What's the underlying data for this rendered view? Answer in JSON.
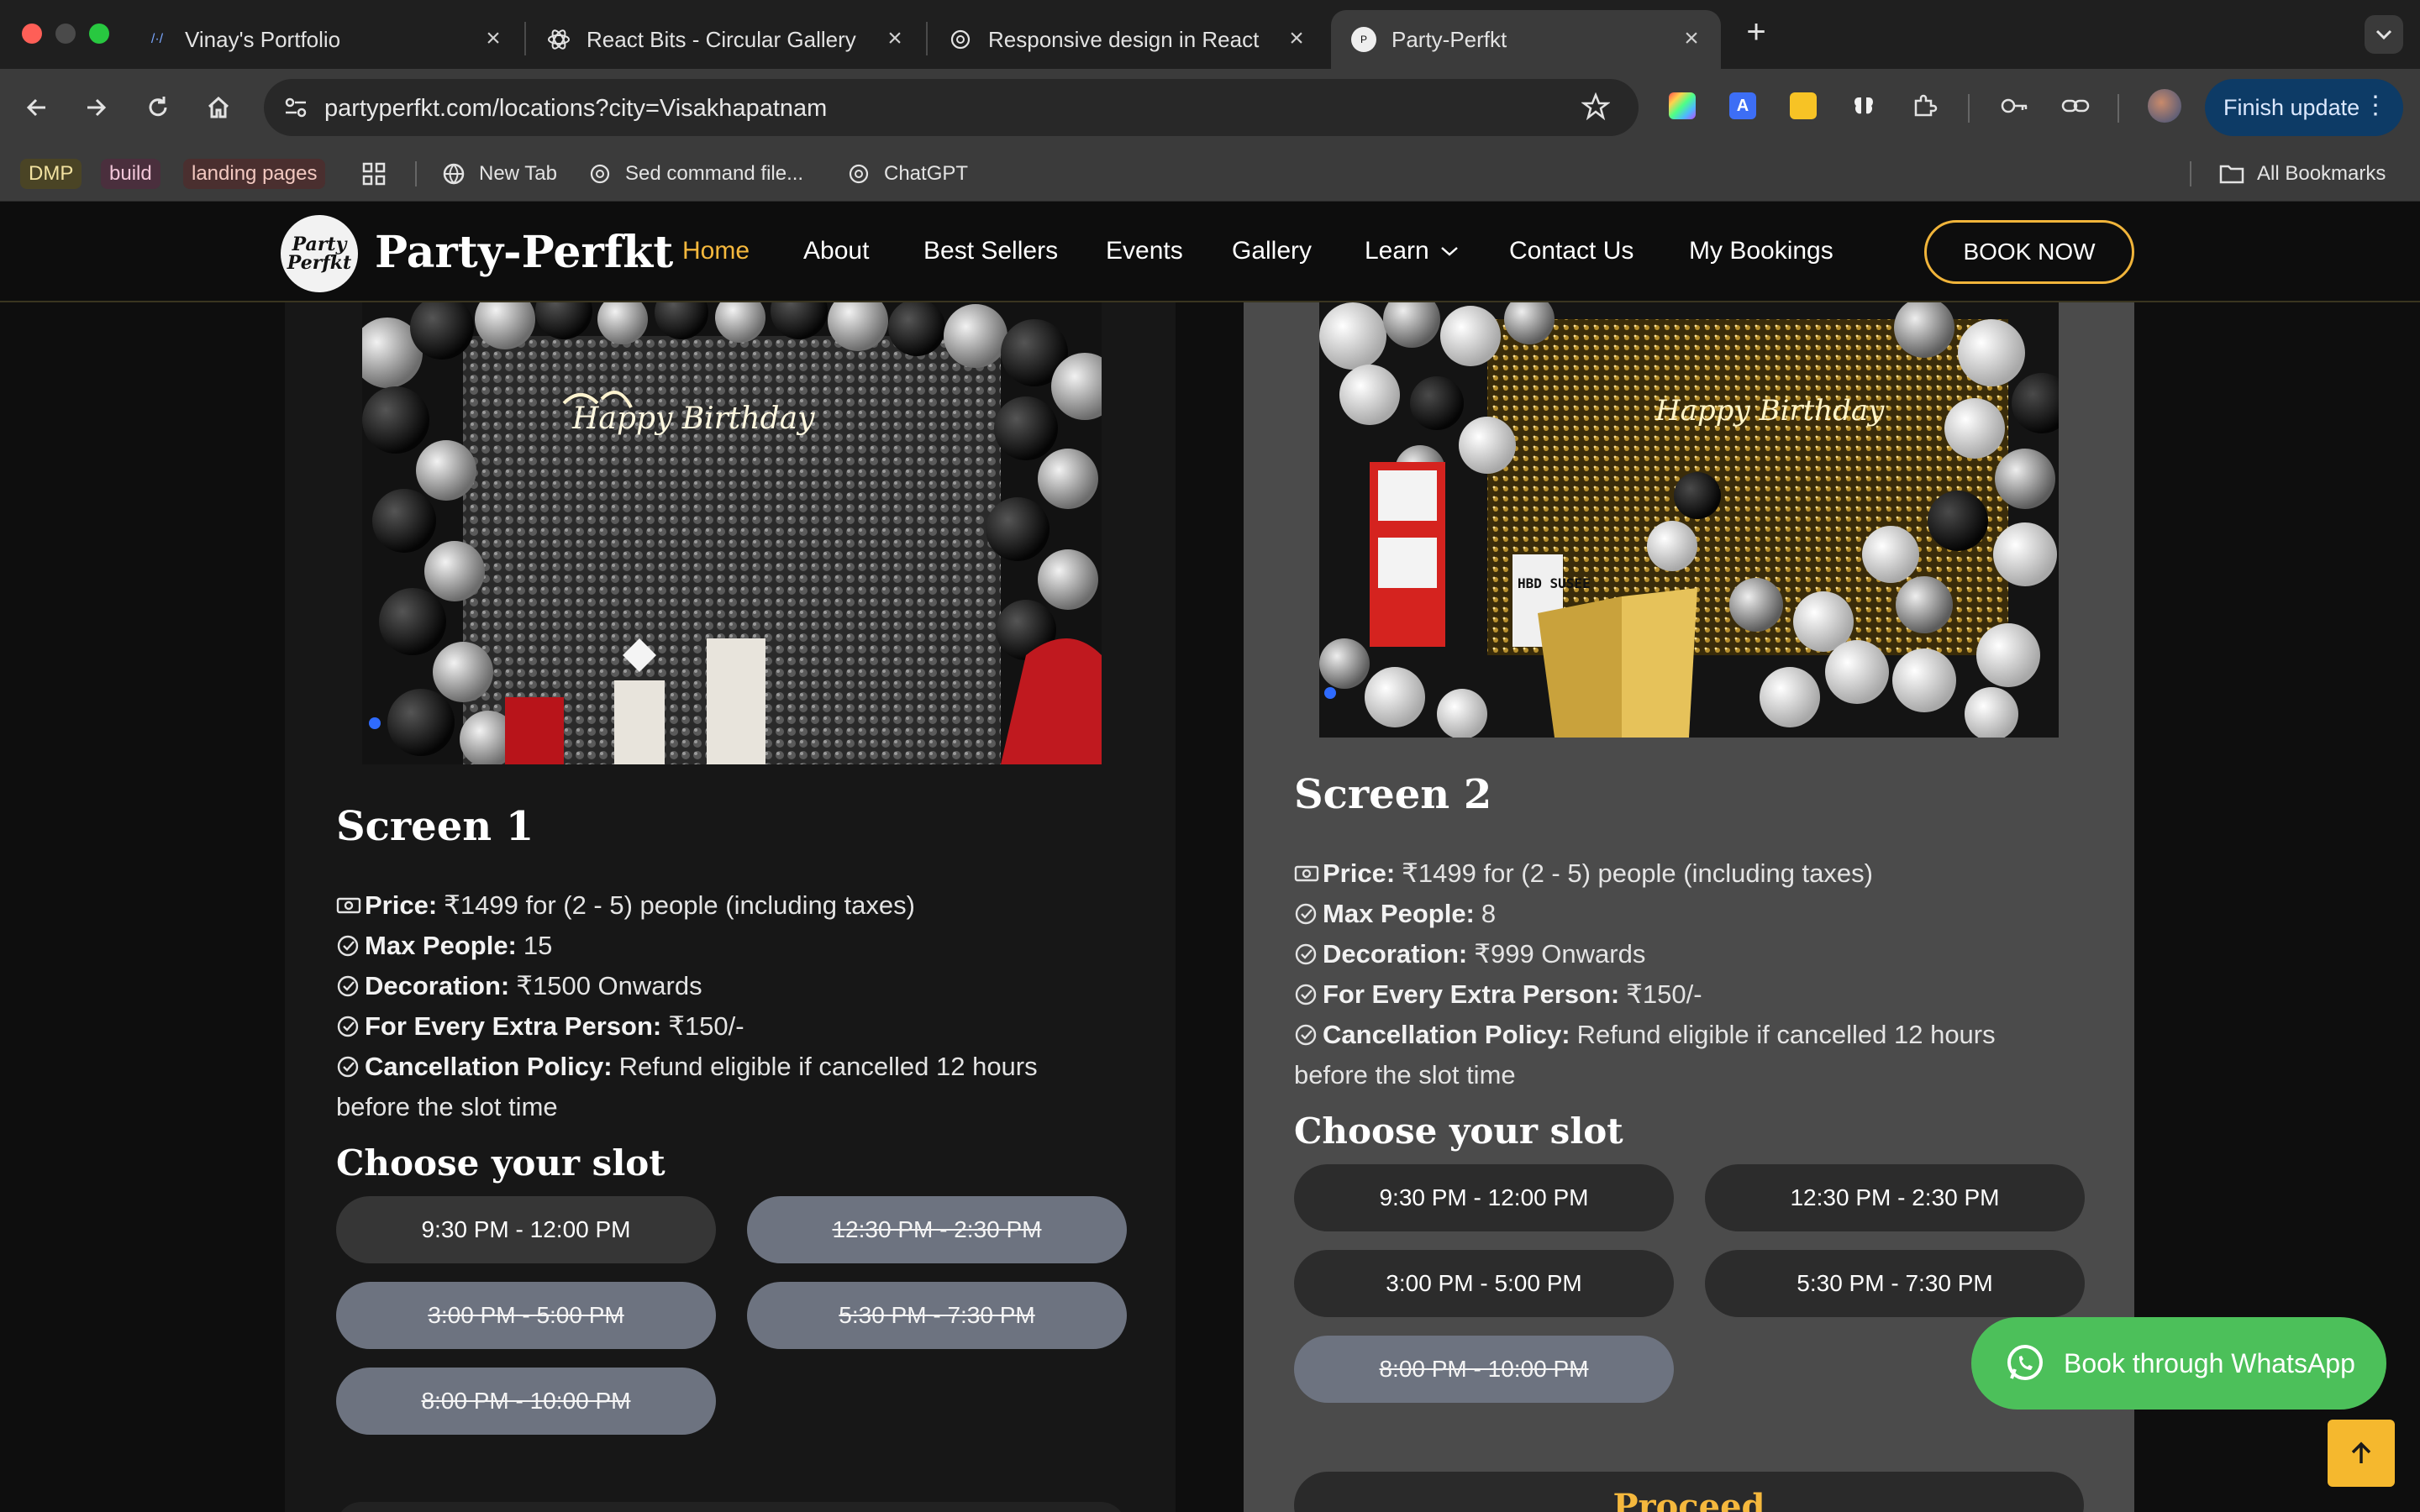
{
  "browser": {
    "tabs": [
      {
        "title": "Vinay's Portfolio"
      },
      {
        "title": "React Bits - Circular Gallery"
      },
      {
        "title": "Responsive design in React"
      },
      {
        "title": "Party-Perfkt"
      }
    ],
    "url_host": "partyperfkt.com",
    "url_path": "/locations?city=Visakhapatnam",
    "finish_update": "Finish update",
    "bookmarks": [
      {
        "label": "DMP"
      },
      {
        "label": "build"
      },
      {
        "label": "landing pages"
      },
      {
        "label": "New Tab"
      },
      {
        "label": "Sed command file..."
      },
      {
        "label": "ChatGPT"
      }
    ],
    "all_bookmarks": "All Bookmarks"
  },
  "site": {
    "logo_text_1": "Party",
    "logo_text_2": "Perfkt",
    "brand": "Party-Perfkt",
    "nav": [
      "Home",
      "About",
      "Best Sellers",
      "Events",
      "Gallery",
      "Learn",
      "Contact Us",
      "My Bookings"
    ],
    "book_now": "BOOK NOW",
    "choose_slot": "Choose your slot",
    "proceed": "Proceed",
    "whatsapp": "Book through WhatsApp"
  },
  "screens": [
    {
      "title": "Screen 1",
      "price_label": "Price:",
      "price": "₹1499 for (2 - 5) people (including taxes)",
      "max_label": "Max People:",
      "max": "15",
      "deco_label": "Decoration:",
      "deco": "₹1500 Onwards",
      "extra_label": "For Every Extra Person:",
      "extra": "₹150/-",
      "cancel_label": "Cancellation Policy:",
      "cancel_1": "Refund eligible if cancelled 12 hours",
      "cancel_2": "before the slot time",
      "photo_sign": "Happy Birthday",
      "slots": [
        {
          "label": "9:30 PM - 12:00 PM",
          "booked": false
        },
        {
          "label": "12:30 PM - 2:30 PM",
          "booked": true
        },
        {
          "label": "3:00 PM - 5:00 PM",
          "booked": true
        },
        {
          "label": "5:30 PM - 7:30 PM",
          "booked": true
        },
        {
          "label": "8:00 PM - 10:00 PM",
          "booked": true
        }
      ]
    },
    {
      "title": "Screen 2",
      "price_label": "Price:",
      "price": "₹1499 for (2 - 5) people (including taxes)",
      "max_label": "Max People:",
      "max": "8",
      "deco_label": "Decoration:",
      "deco": "₹999 Onwards",
      "extra_label": "For Every Extra Person:",
      "extra": "₹150/-",
      "cancel_label": "Cancellation Policy:",
      "cancel_1": "Refund eligible if cancelled 12 hours",
      "cancel_2": "before the slot time",
      "photo_sign": "Happy Birthday",
      "photo_board": "HBD SUSEE",
      "slots": [
        {
          "label": "9:30 PM - 12:00 PM",
          "booked": false
        },
        {
          "label": "12:30 PM - 2:30 PM",
          "booked": false
        },
        {
          "label": "3:00 PM - 5:00 PM",
          "booked": false
        },
        {
          "label": "5:30 PM - 7:30 PM",
          "booked": false
        },
        {
          "label": "8:00 PM - 10:00 PM",
          "booked": true
        }
      ]
    }
  ],
  "colors": {
    "accent": "#f5b83d",
    "whatsapp": "#4cc05a",
    "booked_slot": "#6d7380"
  }
}
